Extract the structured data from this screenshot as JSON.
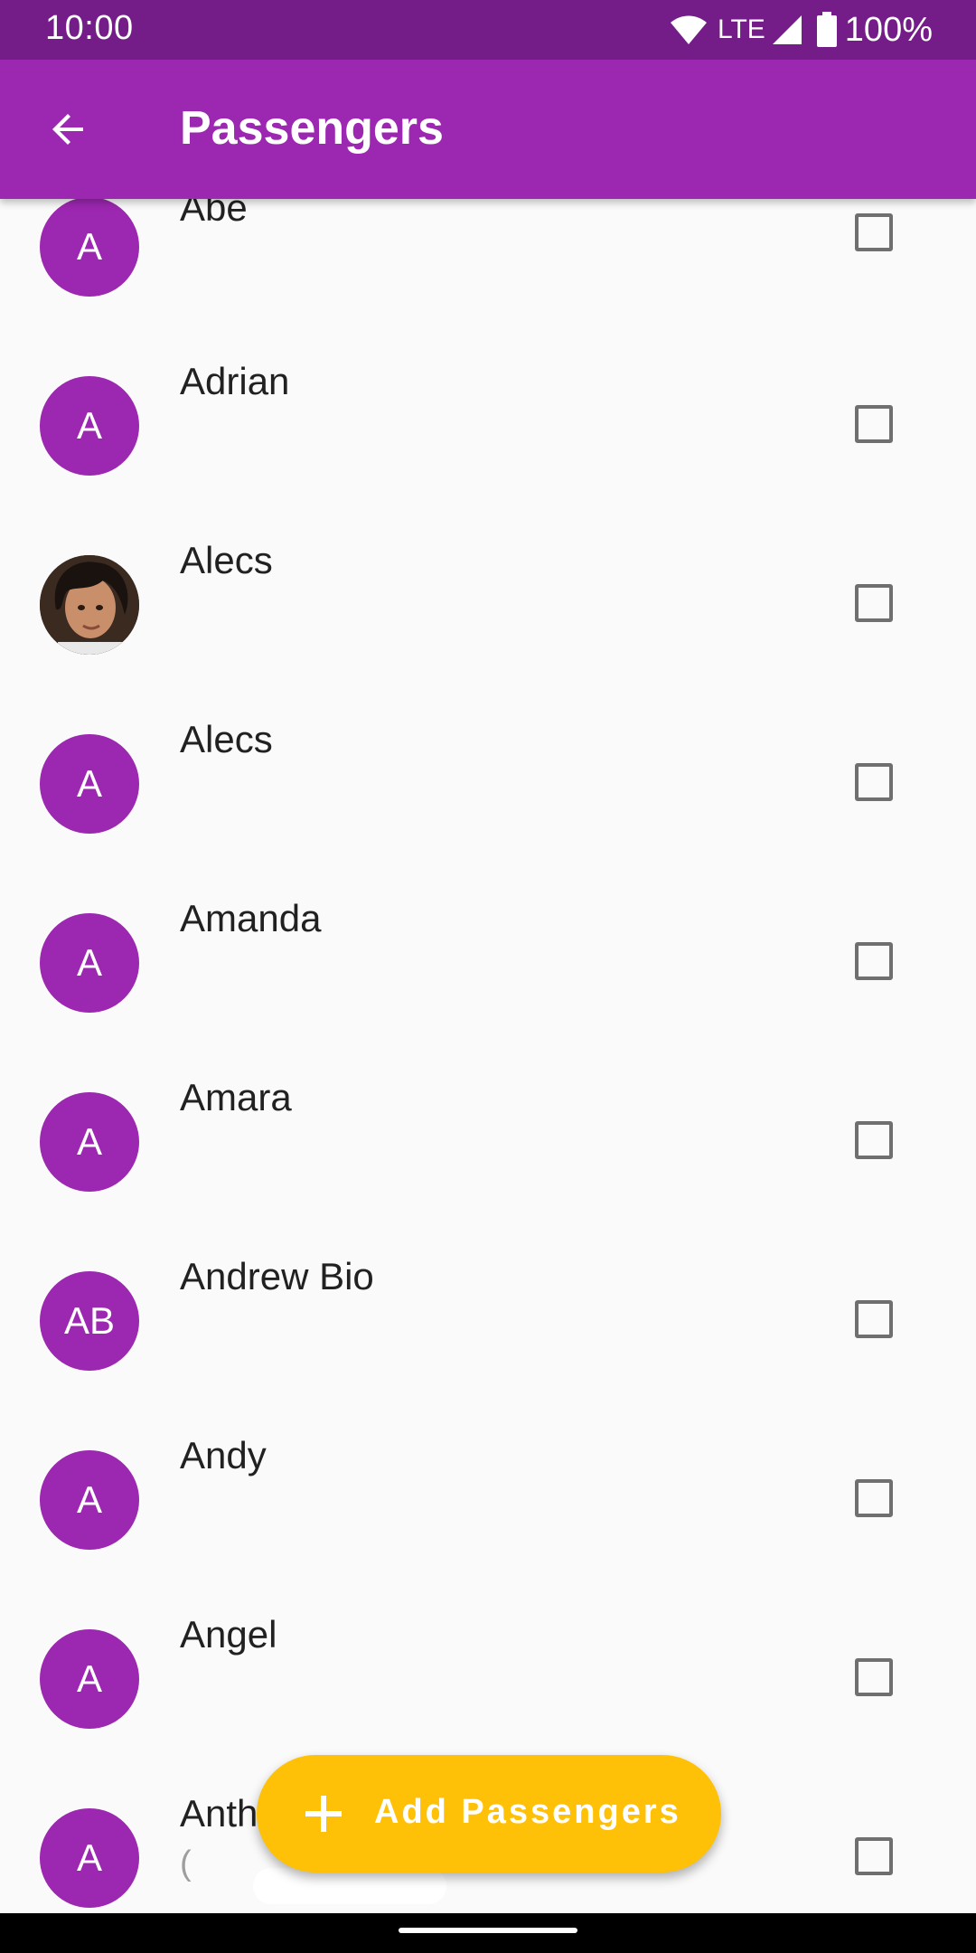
{
  "status_bar": {
    "time": "10:00",
    "network": "LTE",
    "battery": "100%",
    "icons": [
      "wifi-icon",
      "signal-icon",
      "battery-icon"
    ]
  },
  "app_bar": {
    "title": "Passengers",
    "back_icon": "arrow-back-icon"
  },
  "contacts": [
    {
      "initials": "A",
      "name": "Abe",
      "sub": "",
      "photo": false,
      "checked": false
    },
    {
      "initials": "A",
      "name": "Adrian",
      "sub": "",
      "photo": false,
      "checked": false
    },
    {
      "initials": "",
      "name": "Alecs",
      "sub": "",
      "photo": true,
      "checked": false
    },
    {
      "initials": "A",
      "name": "Alecs",
      "sub": "",
      "photo": false,
      "checked": false
    },
    {
      "initials": "A",
      "name": "Amanda",
      "sub": "",
      "photo": false,
      "checked": false
    },
    {
      "initials": "A",
      "name": "Amara",
      "sub": "",
      "photo": false,
      "checked": false
    },
    {
      "initials": "AB",
      "name": "Andrew Bio",
      "sub": "",
      "photo": false,
      "checked": false
    },
    {
      "initials": "A",
      "name": "Andy",
      "sub": "",
      "photo": false,
      "checked": false
    },
    {
      "initials": "A",
      "name": "Angel",
      "sub": "",
      "photo": false,
      "checked": false
    },
    {
      "initials": "A",
      "name": "Anth",
      "sub": "(",
      "photo": false,
      "checked": false
    }
  ],
  "fab": {
    "label": "Add Passengers",
    "icon": "plus-icon"
  },
  "colors": {
    "status_bar": "#741c87",
    "app_bar": "#9c27b0",
    "avatar": "#9c27b0",
    "fab": "#ffc107"
  }
}
